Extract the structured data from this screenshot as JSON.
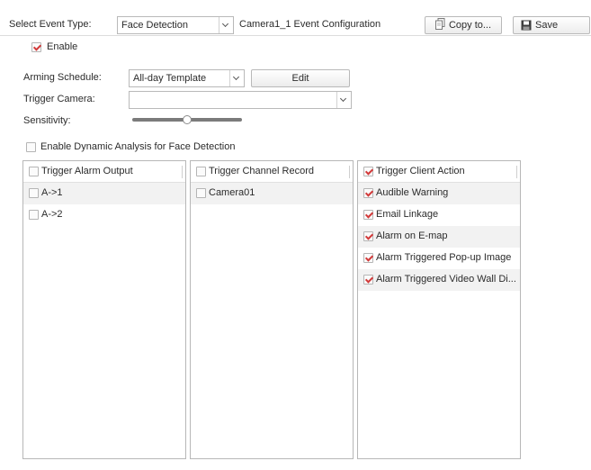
{
  "header": {
    "event_type_label": "Select Event Type:",
    "event_type_value": "Face Detection",
    "config_title": "Camera1_1 Event Configuration",
    "copy_label": "Copy to...",
    "save_label": "Save"
  },
  "enable": {
    "label": "Enable",
    "checked": true
  },
  "arming": {
    "label": "Arming Schedule:",
    "value": "All-day Template",
    "edit_label": "Edit"
  },
  "trigger_camera": {
    "label": "Trigger Camera:",
    "value": ""
  },
  "sensitivity": {
    "label": "Sensitivity:",
    "level_fraction": 0.5
  },
  "dynamic_analysis": {
    "label": "Enable Dynamic Analysis for Face Detection",
    "checked": false
  },
  "panels": {
    "alarm_output": {
      "header": "Trigger Alarm Output",
      "items": [
        {
          "label": "A->1",
          "checked": false
        },
        {
          "label": "A->2",
          "checked": false
        }
      ]
    },
    "channel_record": {
      "header": "Trigger Channel Record",
      "items": [
        {
          "label": "Camera01",
          "checked": false
        }
      ]
    },
    "client_action": {
      "header": "Trigger Client Action",
      "header_checked": true,
      "items": [
        {
          "label": "Audible Warning",
          "checked": true
        },
        {
          "label": "Email Linkage",
          "checked": true
        },
        {
          "label": "Alarm on E-map",
          "checked": true
        },
        {
          "label": "Alarm Triggered Pop-up Image",
          "checked": true
        },
        {
          "label": "Alarm Triggered Video Wall Di...",
          "checked": true
        }
      ]
    }
  },
  "colors": {
    "check_mark": "#d23a3a",
    "border": "#b7b7b7",
    "row_shade": "#f2f2f2"
  }
}
